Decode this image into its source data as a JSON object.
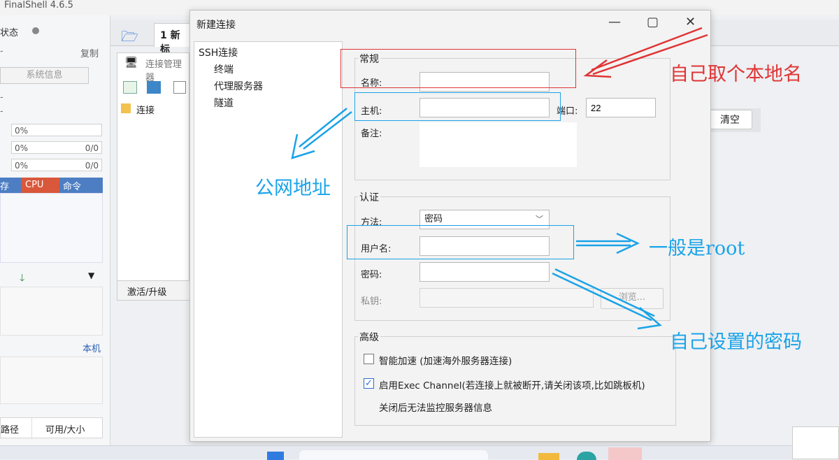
{
  "app": {
    "title": "FinalShell 4.6.5"
  },
  "left_panel": {
    "status_label": "状态",
    "copy_label": "复制",
    "sysinfo_button": "系统信息",
    "dash1": "-",
    "dash2": "-",
    "pct1": "0%",
    "pct2": "0%",
    "pct3": "0%",
    "ratio2": "0/0",
    "ratio3": "0/0",
    "col_mem": "存",
    "col_cpu": "CPU",
    "col_cmd": "命令",
    "local_label": "本机",
    "path_col": "路径",
    "avail_col": "可用/大小"
  },
  "tabs": {
    "tab1": "1 新标"
  },
  "conn_manager": {
    "title": "连接管理器",
    "folder": "连接",
    "activate": "激活/升级"
  },
  "right_area": {
    "clear_button": "清空"
  },
  "dialog": {
    "title": "新建连接",
    "nav": [
      "SSH连接",
      "终端",
      "代理服务器",
      "隧道"
    ],
    "general": {
      "legend": "常规",
      "name_label": "名称:",
      "name_value": "",
      "host_label": "主机:",
      "host_value": "",
      "port_label": "端口:",
      "port_value": "22",
      "note_label": "备注:"
    },
    "auth": {
      "legend": "认证",
      "method_label": "方法:",
      "method_value": "密码",
      "user_label": "用户名:",
      "password_label": "密码:",
      "key_label": "私钥:",
      "browse_button": "浏览..."
    },
    "advanced": {
      "legend": "高级",
      "accel_label": "智能加速 (加速海外服务器连接)",
      "accel_checked": false,
      "exec_label": "启用Exec Channel(若连接上就被断开,请关闭该项,比如跳板机)",
      "exec_checked": true,
      "exec_note": "关闭后无法监控服务器信息"
    }
  },
  "annotations": {
    "name_hint": "自己取个本地名",
    "host_hint": "公网地址",
    "user_hint": "一般是root",
    "password_hint": "自己设置的密码",
    "red_color": "#e03434",
    "blue_color": "#1aa3e8"
  }
}
